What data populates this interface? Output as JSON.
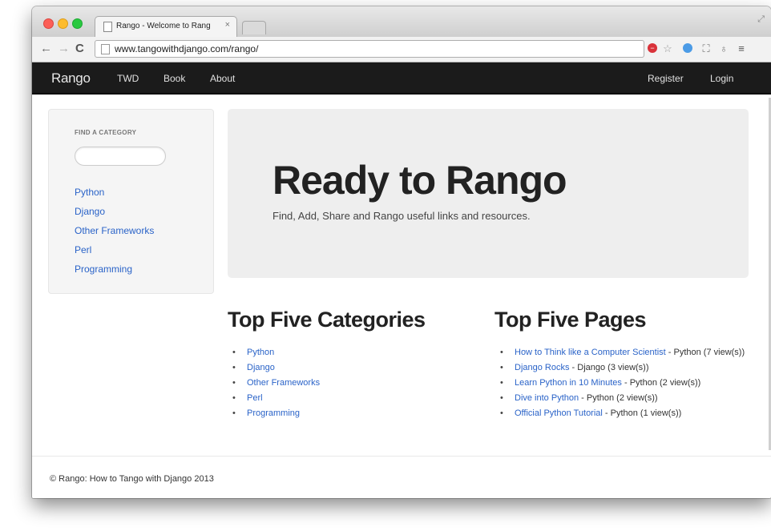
{
  "browser": {
    "tab_title": "Rango - Welcome to Rang",
    "tab_close": "×",
    "url": "www.tangowithdjango.com/rango/"
  },
  "navbar": {
    "brand": "Rango",
    "links": [
      "TWD",
      "Book",
      "About"
    ],
    "right_links": [
      "Register",
      "Login"
    ]
  },
  "sidebar": {
    "heading": "FIND A CATEGORY",
    "search_value": "",
    "categories": [
      "Python",
      "Django",
      "Other Frameworks",
      "Perl",
      "Programming"
    ]
  },
  "hero": {
    "title": "Ready to Rango",
    "subtitle": "Find, Add, Share and Rango useful links and resources."
  },
  "top_categories": {
    "title": "Top Five Categories",
    "items": [
      "Python",
      "Django",
      "Other Frameworks",
      "Perl",
      "Programming"
    ]
  },
  "top_pages": {
    "title": "Top Five Pages",
    "items": [
      {
        "title": "How to Think like a Computer Scientist",
        "meta": " - Python (7 view(s))"
      },
      {
        "title": "Django Rocks",
        "meta": " - Django (3 view(s))"
      },
      {
        "title": "Learn Python in 10 Minutes",
        "meta": " - Python (2 view(s))"
      },
      {
        "title": "Dive into Python",
        "meta": " - Python (2 view(s))"
      },
      {
        "title": "Official Python Tutorial",
        "meta": " - Python (1 view(s))"
      }
    ]
  },
  "footer": {
    "text": "© Rango: How to Tango with Django 2013"
  },
  "colors": {
    "navbar": "#1b1b1b",
    "link": "#2a63c8",
    "hero_bg": "#eeeeee"
  }
}
